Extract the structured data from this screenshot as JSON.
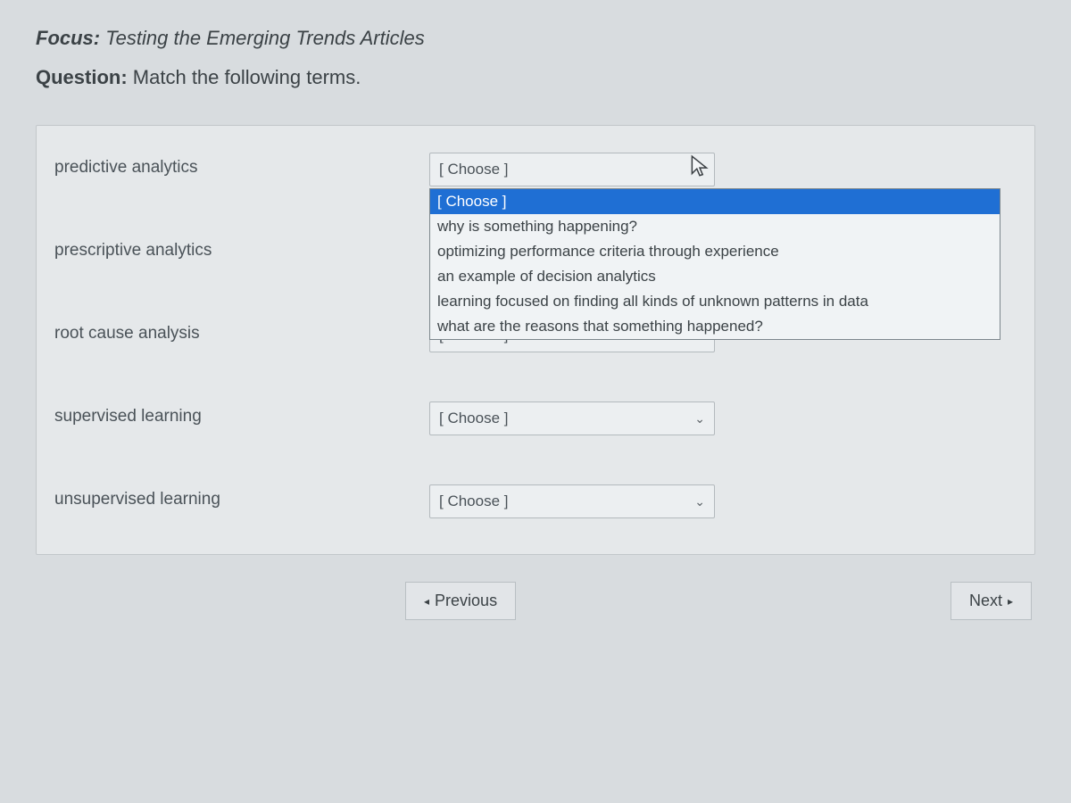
{
  "focus": {
    "label": "Focus:",
    "text": "Testing the Emerging Trends Articles"
  },
  "question": {
    "label": "Question:",
    "text": "Match the following terms."
  },
  "terms": [
    "predictive analytics",
    "prescriptive analytics",
    "root cause analysis",
    "supervised learning",
    "unsupervised learning"
  ],
  "select_placeholder": "[ Choose ]",
  "dropdown_options": [
    "[ Choose ]",
    "why is something happening?",
    "optimizing performance criteria through experience",
    "an example of decision analytics",
    "learning focused on finding all kinds of unknown patterns in data",
    "what are the reasons that something happened?"
  ],
  "nav": {
    "previous": "Previous",
    "next": "Next"
  }
}
